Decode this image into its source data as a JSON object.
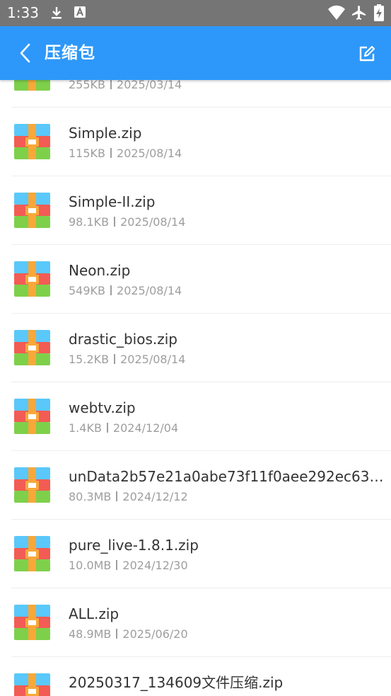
{
  "status_bar": {
    "time": "1:33",
    "icons": [
      "download-icon",
      "accessibility-a-icon",
      "wifi-icon",
      "airplane-mode-icon",
      "battery-charging-icon"
    ]
  },
  "app_bar": {
    "title": "压缩包",
    "back_icon": "chevron-left-icon",
    "edit_icon": "edit-icon"
  },
  "colors": {
    "app_bar": "#2d98f9",
    "status_bar": "#757575",
    "zip_blue": "#5ac8fa",
    "zip_red": "#f25c54",
    "zip_green": "#7ed04b",
    "zip_orange": "#f7a839"
  },
  "files": [
    {
      "name": "",
      "size": "255KB",
      "date": "2025/03/14"
    },
    {
      "name": "Simple.zip",
      "size": "115KB",
      "date": "2025/08/14"
    },
    {
      "name": "Simple-II.zip",
      "size": "98.1KB",
      "date": "2025/08/14"
    },
    {
      "name": "Neon.zip",
      "size": "549KB",
      "date": "2025/08/14"
    },
    {
      "name": "drastic_bios.zip",
      "size": "15.2KB",
      "date": "2025/08/14"
    },
    {
      "name": "webtv.zip",
      "size": "1.4KB",
      "date": "2024/12/04"
    },
    {
      "name": "unData2b57e21a0abe73f11f0aee292ec630…",
      "size": "80.3MB",
      "date": "2024/12/12"
    },
    {
      "name": "pure_live-1.8.1.zip",
      "size": "10.0MB",
      "date": "2024/12/30"
    },
    {
      "name": "ALL.zip",
      "size": "48.9MB",
      "date": "2025/06/20"
    },
    {
      "name": "20250317_134609文件压缩.zip",
      "size": "",
      "date": ""
    }
  ]
}
